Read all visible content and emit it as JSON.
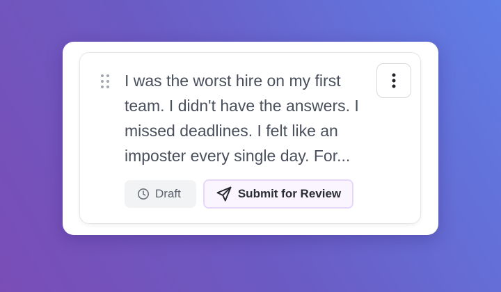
{
  "post": {
    "text": "I was the worst hire on my first\nteam. I didn't have the answers. I\nmissed deadlines. I felt like an\nimposter every single day. For...",
    "status_label": "Draft",
    "status_icon": "clock-icon",
    "submit_label": "Submit for Review",
    "submit_icon": "send-icon",
    "more_icon": "more-vertical-icon",
    "drag_icon": "drag-handle-icon"
  },
  "colors": {
    "background_gradient_start": "#7a4db6",
    "background_gradient_end": "#5f7ee6",
    "submit_accent": "#e7d8fb"
  }
}
